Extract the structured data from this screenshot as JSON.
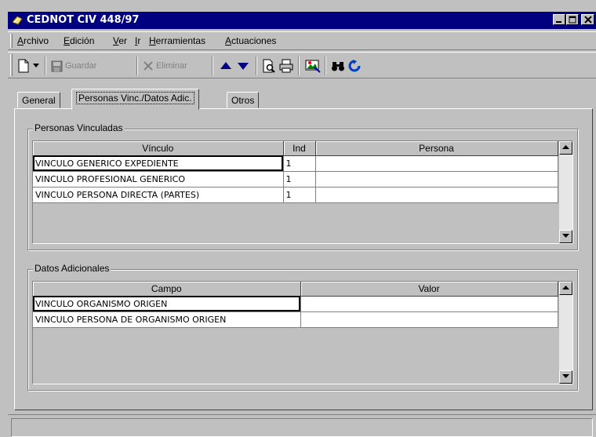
{
  "window": {
    "title": "CEDNOT CIV 448/97",
    "controls": [
      "minimize",
      "maximize",
      "close"
    ]
  },
  "menu": [
    {
      "label": "Archivo"
    },
    {
      "label": "Edición"
    },
    {
      "label": "Ver"
    },
    {
      "label": "Ir"
    },
    {
      "label": "Herramientas"
    },
    {
      "label": "Actuaciones"
    }
  ],
  "toolbar": {
    "save_label": "Guardar",
    "delete_label": "Eliminar",
    "icons": [
      "new-document-icon",
      "dropdown-arrow-icon",
      "save-icon",
      "delete-icon",
      "arrow-up-icon",
      "arrow-down-icon",
      "print-preview-icon",
      "print-icon",
      "image-icon",
      "binoculars-icon",
      "refresh-icon"
    ]
  },
  "tabs": [
    {
      "label": "General",
      "active": false
    },
    {
      "label": "Personas Vinc./Datos Adic.",
      "active": true
    },
    {
      "label": "Otros",
      "active": false
    }
  ],
  "personas": {
    "title": "Personas Vinculadas",
    "columns": [
      "Vínculo",
      "Ind",
      "Persona"
    ],
    "rows": [
      [
        "VINCULO GENERICO EXPEDIENTE",
        "1",
        ""
      ],
      [
        "VINCULO PROFESIONAL GENERICO",
        "1",
        ""
      ],
      [
        "VINCULO PERSONA DIRECTA (PARTES)",
        "1",
        ""
      ]
    ]
  },
  "datos": {
    "title": "Datos Adicionales",
    "columns": [
      "Campo",
      "Valor"
    ],
    "rows": [
      [
        "VINCULO ORGANISMO ORIGEN",
        ""
      ],
      [
        "VINCULO PERSONA DE ORGANISMO ORIGEN",
        ""
      ]
    ]
  },
  "colors": {
    "titlebar": "#000080",
    "face": "#c0c0c0",
    "arrow_blue": "#000080"
  }
}
